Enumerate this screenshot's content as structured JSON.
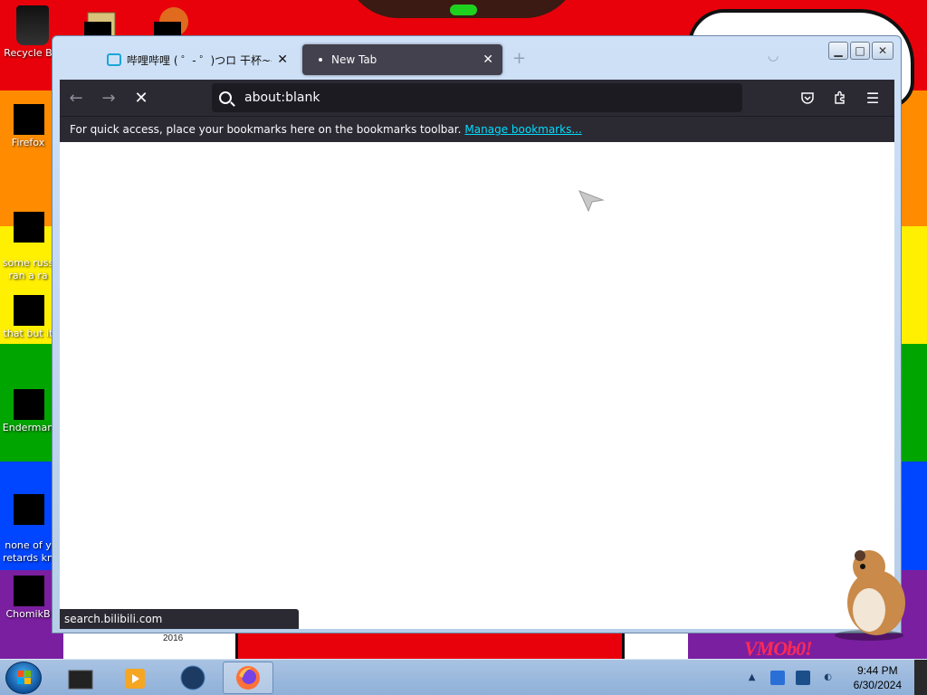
{
  "desktop": {
    "icons": [
      {
        "label": "Recycle B"
      },
      {
        "label": "Firefox"
      },
      {
        "label": "some russ\nran a ra"
      },
      {
        "label": "that but it"
      },
      {
        "label": "Enderman"
      },
      {
        "label": "none of y\nretards kn"
      },
      {
        "label": "ChomikB"
      }
    ],
    "bottom_label": "2016",
    "watermark": "VMOb0!"
  },
  "browser": {
    "tabs": [
      {
        "label": "哔哩哔哩 ( ゜- ゜)つロ 干杯~-bili",
        "active": false
      },
      {
        "label": "New Tab",
        "active": true
      }
    ],
    "new_tab_label": "+",
    "url": "about:blank",
    "bookmarks_bar": {
      "message": "For quick access, place your bookmarks here on the bookmarks toolbar.",
      "link": "Manage bookmarks..."
    },
    "status_text": "search.bilibili.com",
    "colors": {
      "toolbar": "#2b2a33",
      "link": "#00ddff"
    }
  },
  "taskbar": {
    "clock_time": "9:44 PM",
    "clock_date": "6/30/2024"
  }
}
